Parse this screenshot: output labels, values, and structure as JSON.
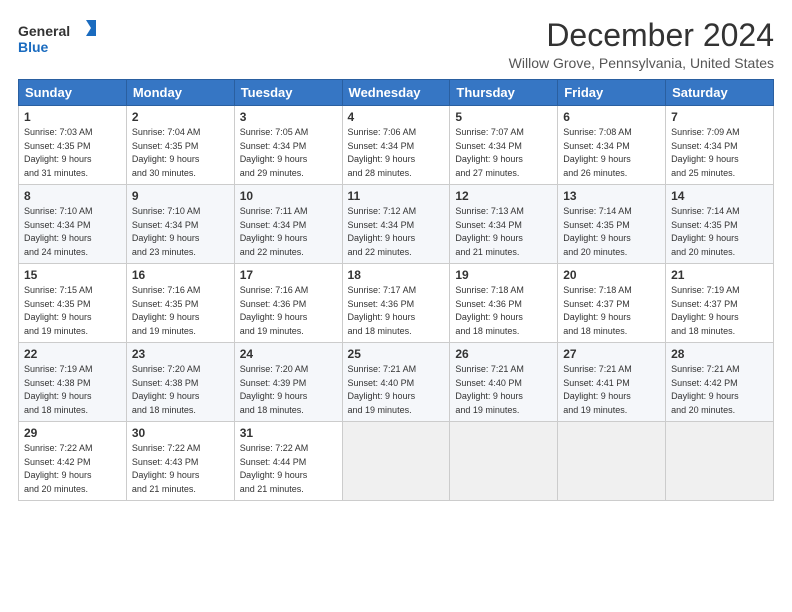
{
  "logo": {
    "text_general": "General",
    "text_blue": "Blue"
  },
  "header": {
    "month_title": "December 2024",
    "location": "Willow Grove, Pennsylvania, United States"
  },
  "weekdays": [
    "Sunday",
    "Monday",
    "Tuesday",
    "Wednesday",
    "Thursday",
    "Friday",
    "Saturday"
  ],
  "weeks": [
    [
      {
        "day": "1",
        "info": "Sunrise: 7:03 AM\nSunset: 4:35 PM\nDaylight: 9 hours\nand 31 minutes."
      },
      {
        "day": "2",
        "info": "Sunrise: 7:04 AM\nSunset: 4:35 PM\nDaylight: 9 hours\nand 30 minutes."
      },
      {
        "day": "3",
        "info": "Sunrise: 7:05 AM\nSunset: 4:34 PM\nDaylight: 9 hours\nand 29 minutes."
      },
      {
        "day": "4",
        "info": "Sunrise: 7:06 AM\nSunset: 4:34 PM\nDaylight: 9 hours\nand 28 minutes."
      },
      {
        "day": "5",
        "info": "Sunrise: 7:07 AM\nSunset: 4:34 PM\nDaylight: 9 hours\nand 27 minutes."
      },
      {
        "day": "6",
        "info": "Sunrise: 7:08 AM\nSunset: 4:34 PM\nDaylight: 9 hours\nand 26 minutes."
      },
      {
        "day": "7",
        "info": "Sunrise: 7:09 AM\nSunset: 4:34 PM\nDaylight: 9 hours\nand 25 minutes."
      }
    ],
    [
      {
        "day": "8",
        "info": "Sunrise: 7:10 AM\nSunset: 4:34 PM\nDaylight: 9 hours\nand 24 minutes."
      },
      {
        "day": "9",
        "info": "Sunrise: 7:10 AM\nSunset: 4:34 PM\nDaylight: 9 hours\nand 23 minutes."
      },
      {
        "day": "10",
        "info": "Sunrise: 7:11 AM\nSunset: 4:34 PM\nDaylight: 9 hours\nand 22 minutes."
      },
      {
        "day": "11",
        "info": "Sunrise: 7:12 AM\nSunset: 4:34 PM\nDaylight: 9 hours\nand 22 minutes."
      },
      {
        "day": "12",
        "info": "Sunrise: 7:13 AM\nSunset: 4:34 PM\nDaylight: 9 hours\nand 21 minutes."
      },
      {
        "day": "13",
        "info": "Sunrise: 7:14 AM\nSunset: 4:35 PM\nDaylight: 9 hours\nand 20 minutes."
      },
      {
        "day": "14",
        "info": "Sunrise: 7:14 AM\nSunset: 4:35 PM\nDaylight: 9 hours\nand 20 minutes."
      }
    ],
    [
      {
        "day": "15",
        "info": "Sunrise: 7:15 AM\nSunset: 4:35 PM\nDaylight: 9 hours\nand 19 minutes."
      },
      {
        "day": "16",
        "info": "Sunrise: 7:16 AM\nSunset: 4:35 PM\nDaylight: 9 hours\nand 19 minutes."
      },
      {
        "day": "17",
        "info": "Sunrise: 7:16 AM\nSunset: 4:36 PM\nDaylight: 9 hours\nand 19 minutes."
      },
      {
        "day": "18",
        "info": "Sunrise: 7:17 AM\nSunset: 4:36 PM\nDaylight: 9 hours\nand 18 minutes."
      },
      {
        "day": "19",
        "info": "Sunrise: 7:18 AM\nSunset: 4:36 PM\nDaylight: 9 hours\nand 18 minutes."
      },
      {
        "day": "20",
        "info": "Sunrise: 7:18 AM\nSunset: 4:37 PM\nDaylight: 9 hours\nand 18 minutes."
      },
      {
        "day": "21",
        "info": "Sunrise: 7:19 AM\nSunset: 4:37 PM\nDaylight: 9 hours\nand 18 minutes."
      }
    ],
    [
      {
        "day": "22",
        "info": "Sunrise: 7:19 AM\nSunset: 4:38 PM\nDaylight: 9 hours\nand 18 minutes."
      },
      {
        "day": "23",
        "info": "Sunrise: 7:20 AM\nSunset: 4:38 PM\nDaylight: 9 hours\nand 18 minutes."
      },
      {
        "day": "24",
        "info": "Sunrise: 7:20 AM\nSunset: 4:39 PM\nDaylight: 9 hours\nand 18 minutes."
      },
      {
        "day": "25",
        "info": "Sunrise: 7:21 AM\nSunset: 4:40 PM\nDaylight: 9 hours\nand 19 minutes."
      },
      {
        "day": "26",
        "info": "Sunrise: 7:21 AM\nSunset: 4:40 PM\nDaylight: 9 hours\nand 19 minutes."
      },
      {
        "day": "27",
        "info": "Sunrise: 7:21 AM\nSunset: 4:41 PM\nDaylight: 9 hours\nand 19 minutes."
      },
      {
        "day": "28",
        "info": "Sunrise: 7:21 AM\nSunset: 4:42 PM\nDaylight: 9 hours\nand 20 minutes."
      }
    ],
    [
      {
        "day": "29",
        "info": "Sunrise: 7:22 AM\nSunset: 4:42 PM\nDaylight: 9 hours\nand 20 minutes."
      },
      {
        "day": "30",
        "info": "Sunrise: 7:22 AM\nSunset: 4:43 PM\nDaylight: 9 hours\nand 21 minutes."
      },
      {
        "day": "31",
        "info": "Sunrise: 7:22 AM\nSunset: 4:44 PM\nDaylight: 9 hours\nand 21 minutes."
      },
      null,
      null,
      null,
      null
    ]
  ]
}
